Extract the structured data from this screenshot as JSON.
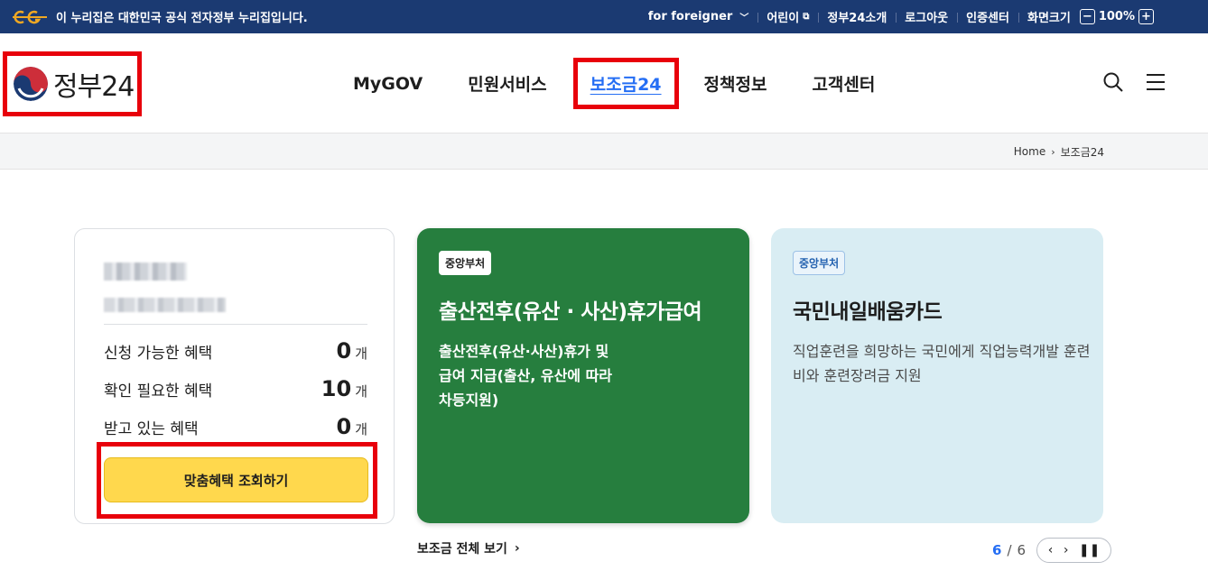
{
  "topbar": {
    "notice": "이 누리집은 대한민국 공식 전자정부 누리집입니다.",
    "links": [
      "for foreigner",
      "어린이",
      "정부24소개",
      "로그아웃",
      "인증센터"
    ],
    "zoom_label": "화면크기",
    "zoom_value": "100%",
    "zoom_minus": "−",
    "zoom_plus": "+"
  },
  "header": {
    "logo_text": "정부24",
    "menu": [
      "MyGOV",
      "민원서비스",
      "보조금24",
      "정책정보",
      "고객센터"
    ],
    "active_menu": "보조금24"
  },
  "breadcrumb": {
    "home": "Home",
    "current": "보조금24"
  },
  "user_card": {
    "rows": [
      {
        "label": "신청 가능한 혜택",
        "count": "0",
        "unit": "개"
      },
      {
        "label": "확인 필요한 혜택",
        "count": "10",
        "unit": "개"
      },
      {
        "label": "받고 있는 혜택",
        "count": "0",
        "unit": "개"
      }
    ],
    "cta": "맞춤혜택 조회하기"
  },
  "cards": [
    {
      "tag": "중앙부처",
      "title": "출산전후(유산 · 사산)휴가급여",
      "desc": "출산전후(유산·사산)휴가 및 급여 지급(출산, 유산에 따라 차등지원)"
    },
    {
      "tag": "중앙부처",
      "title": "국민내일배움카드",
      "desc": "직업훈련을 희망하는 국민에게 직업능력개발 훈련비와 훈련장려금 지원"
    }
  ],
  "view_all": "보조금 전체 보기",
  "pager": {
    "current": "6",
    "total": "6",
    "separator": "/"
  },
  "colors": {
    "topbar": "#1b3a72",
    "accent": "#256ef4",
    "highlight": "#e8000b",
    "card_green": "#267e3e",
    "card_blue": "#d9edf3",
    "cta": "#ffd84d"
  }
}
